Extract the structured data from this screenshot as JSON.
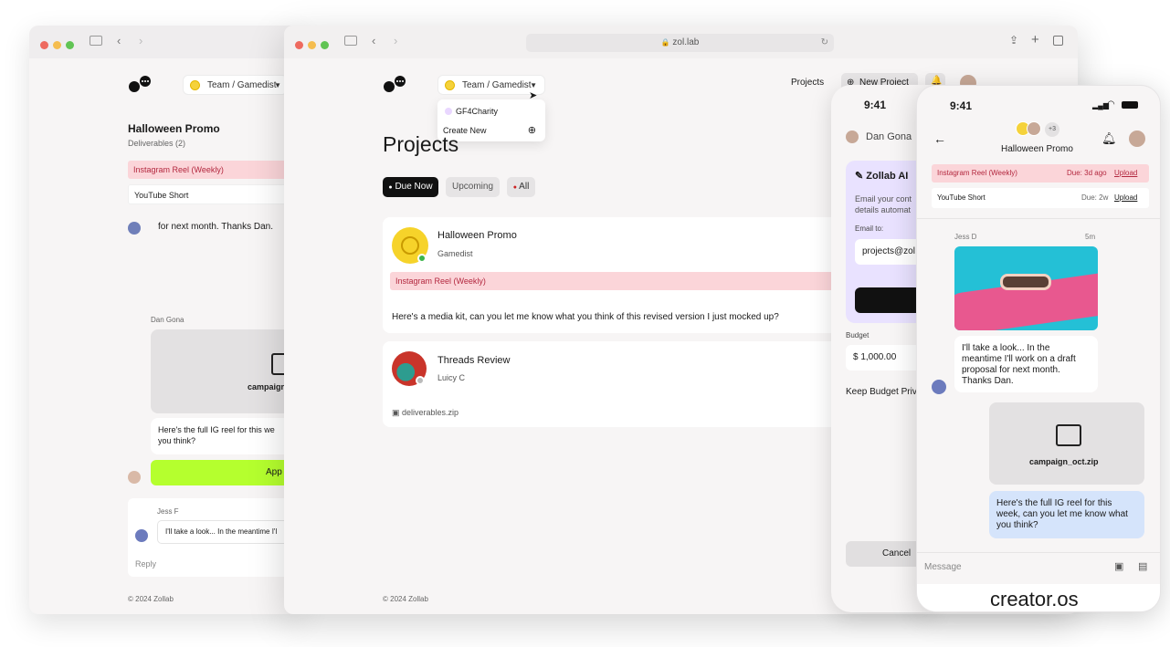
{
  "back_window": {
    "team_select": "Team / Gamedist",
    "project_title": "Halloween Promo",
    "deliverables_count": "Deliverables (2)",
    "deliverables": [
      "Instagram Reel (Weekly)",
      "YouTube Short"
    ],
    "message_partial": "for next month. Thanks Dan.",
    "sender_name": "Dan Gona",
    "file_name_partial": "campaign",
    "reel_message": "Here's the full IG reel for this we... you think?",
    "reel_message_line1": "Here's the full IG reel for this we",
    "reel_message_line2": "you think?",
    "approve_label": "App",
    "reply_author": "Jess F",
    "reply_text": "I'll take a look... In the meantime I'l",
    "reply_placeholder": "Reply",
    "footer": "© 2024 Zollab"
  },
  "main_window": {
    "url": "zol.lab",
    "team_select": "Team / Gamedist",
    "dropdown": {
      "options": [
        "GF4Charity",
        "Create New"
      ]
    },
    "nav": {
      "projects": "Projects",
      "new_project": "New Project"
    },
    "page_title": "Projects",
    "filters": [
      "Due Now",
      "Upcoming",
      "All"
    ],
    "projects": [
      {
        "title": "Halloween Promo",
        "client": "Gamedist",
        "tag": "Instagram Reel (Weekly)",
        "message": "Here's a media kit, can you let me know what you think of this revised version I just mocked up?"
      },
      {
        "title": "Threads Review",
        "client": "Luicy C",
        "attachment": "deliverables.zip"
      }
    ],
    "footer": "© 2024 Zollab"
  },
  "phone_ai": {
    "time": "9:41",
    "user_name": "Dan Gona",
    "panel_title": "Zollab AI",
    "panel_text_line1": "Email your cont",
    "panel_text_line2": "details automat",
    "email_label": "Email to:",
    "email_value": "projects@zol",
    "budget_label": "Budget",
    "budget_value": "$ 1,000.00",
    "budget_toggle": "Keep Budget Priv",
    "cancel_label": "Cancel"
  },
  "phone_chat": {
    "time": "9:41",
    "extra_members": "+3",
    "title": "Halloween Promo",
    "deliverables": [
      {
        "name": "Instagram Reel (Weekly)",
        "due": "Due: 3d ago",
        "action": "Upload"
      },
      {
        "name": "YouTube Short",
        "due": "Due: 2w",
        "action": "Upload"
      }
    ],
    "message_author": "Jess D",
    "message_time": "5m",
    "message_text": "I'll take a look... In the meantime I'll work on a draft proposal for next month. Thanks Dan.",
    "file_name": "campaign_oct.zip",
    "reply_text": "Here's the full IG reel for this week, can you let me know what you think?",
    "input_placeholder": "Message",
    "brand": "creator.os"
  },
  "colors": {
    "accent_pink": "#fbd5d9",
    "accent_lime": "#b5ff2e",
    "accent_purple": "#e9e2ff",
    "bubble_blue": "#d5e4fb",
    "dark": "#111111"
  }
}
